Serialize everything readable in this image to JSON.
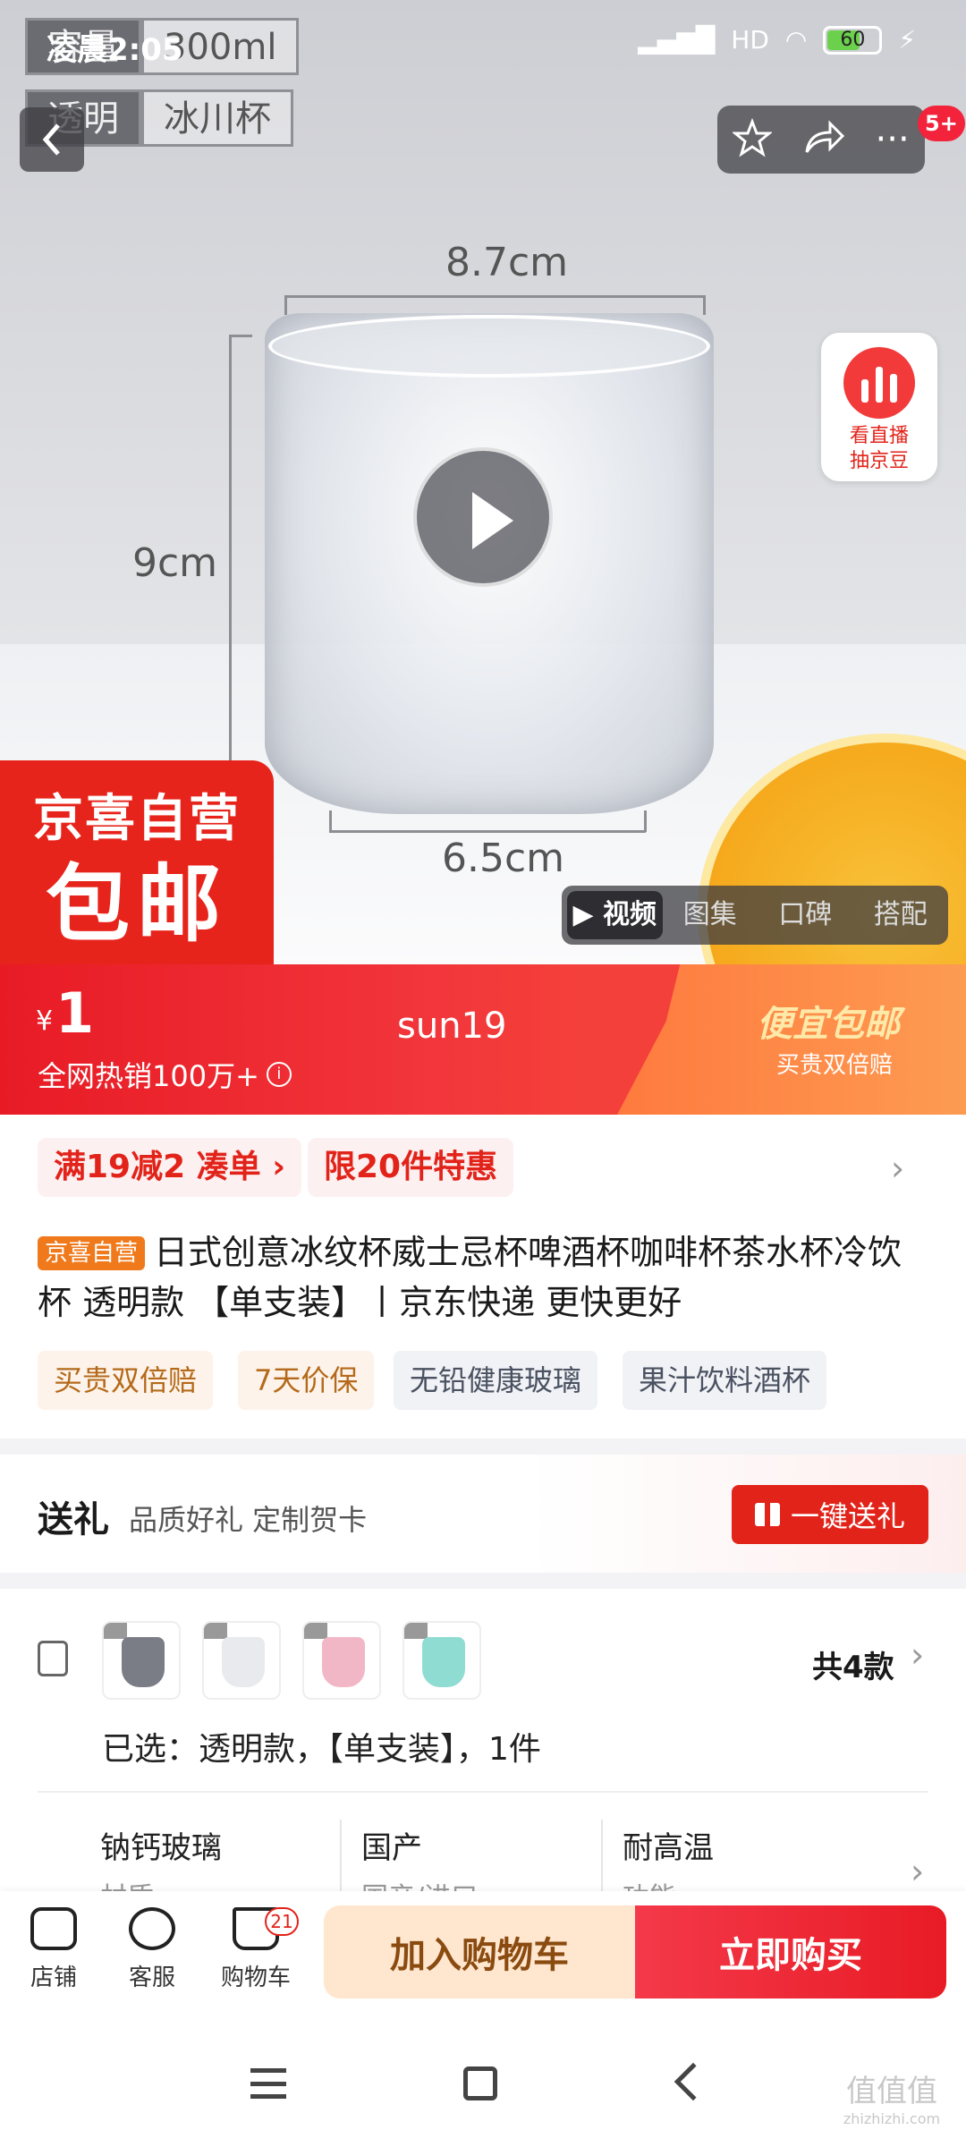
{
  "status_bar": {
    "time": "凌晨2:05",
    "battery": "60",
    "net_label": "HD"
  },
  "hero": {
    "spec_tags": [
      [
        "容量",
        "300ml"
      ],
      [
        "透明",
        "冰川杯"
      ]
    ],
    "dim_width_top": "8.7cm",
    "dim_height": "9cm",
    "dim_width_bottom": "6.5cm",
    "notification_badge": "5+",
    "live_card": {
      "line1": "看直播",
      "line2": "抽京豆"
    },
    "promo_corner": {
      "line1": "京喜自营",
      "line2": "包邮"
    },
    "media_tabs": [
      "视频",
      "图集",
      "口碑",
      "搭配"
    ]
  },
  "price_banner": {
    "currency": "¥",
    "amount": "1",
    "sold": "全网热销100万+",
    "info_icon": "i",
    "code": "sun19",
    "right_title": "便宜包邮",
    "right_sub": "买贵双倍赔"
  },
  "coupons": [
    "满19减2 凑单",
    "限20件特惠"
  ],
  "product": {
    "self_tag": "京喜自营",
    "title": "日式创意冰纹杯威士忌杯啤酒杯咖啡杯茶水杯冷饮杯 透明款 【单支装】丨京东快递 更快更好",
    "chips": [
      "买贵双倍赔",
      "7天价保",
      "无铅健康玻璃",
      "果汁饮料酒杯"
    ]
  },
  "gift": {
    "heading": "送礼",
    "sub": "品质好礼 定制贺卡",
    "button": "一键送礼"
  },
  "variant": {
    "count_label": "共4款",
    "selected": "已选：透明款，【单支装】，1件",
    "thumb_colors": [
      "#7a7d86",
      "#e8eaee",
      "#f2b7c6",
      "#8fdcd3"
    ],
    "specs": [
      {
        "value": "钠钙玻璃",
        "label": "材质"
      },
      {
        "value": "国产",
        "label": "国产/进口"
      },
      {
        "value": "耐高温",
        "label": "功能"
      }
    ]
  },
  "bottom_bar": {
    "items": [
      "店铺",
      "客服",
      "购物车"
    ],
    "cart_badge": "21",
    "add_to_cart": "加入购物车",
    "buy_now": "立即购买"
  },
  "watermark": {
    "main": "值值值",
    "sub": "zhizhizhi.com"
  },
  "colors": {
    "brand_red": "#e2231a",
    "orange": "#f0791b"
  }
}
